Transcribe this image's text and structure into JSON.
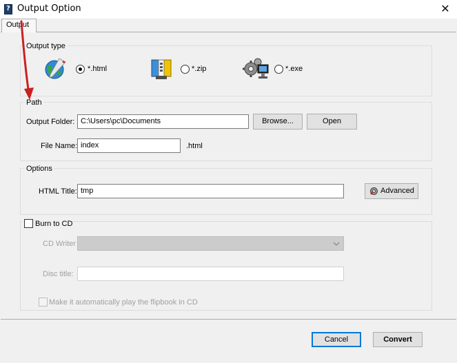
{
  "window": {
    "title": "Output Option",
    "app_icon": "help-book-icon",
    "close_label": "✕"
  },
  "tabs": [
    {
      "label": "Output",
      "selected": true
    }
  ],
  "output_type": {
    "legend": "Output type",
    "options": [
      {
        "label": "*.html",
        "icon": "globe-icon",
        "selected": true
      },
      {
        "label": "*.zip",
        "icon": "zip-archive-icon",
        "selected": false
      },
      {
        "label": "*.exe",
        "icon": "computer-gears-icon",
        "selected": false
      }
    ]
  },
  "path": {
    "legend": "Path",
    "output_folder_label": "Output Folder:",
    "output_folder_value": "C:\\Users\\pc\\Documents",
    "browse_label": "Browse...",
    "open_label": "Open",
    "file_name_label": "File Name:",
    "file_name_value": "index",
    "file_ext": ".html"
  },
  "options": {
    "legend": "Options",
    "html_title_label": "HTML Title:",
    "html_title_value": "tmp",
    "advanced_label": "Advanced",
    "advanced_icon": "gear-icon"
  },
  "burn": {
    "checkbox_label": "Burn to CD",
    "checked": false,
    "cd_writer_label": "CD Writer",
    "cd_writer_value": "",
    "disc_title_label": "Disc title:",
    "disc_title_value": "",
    "autoplay_label": "Make it automatically play the flipbook in CD",
    "autoplay_checked": false
  },
  "footer": {
    "cancel_label": "Cancel",
    "convert_label": "Convert"
  },
  "colors": {
    "arrow_annotation": "#cc1f1f",
    "focus_border": "#0078d7"
  }
}
